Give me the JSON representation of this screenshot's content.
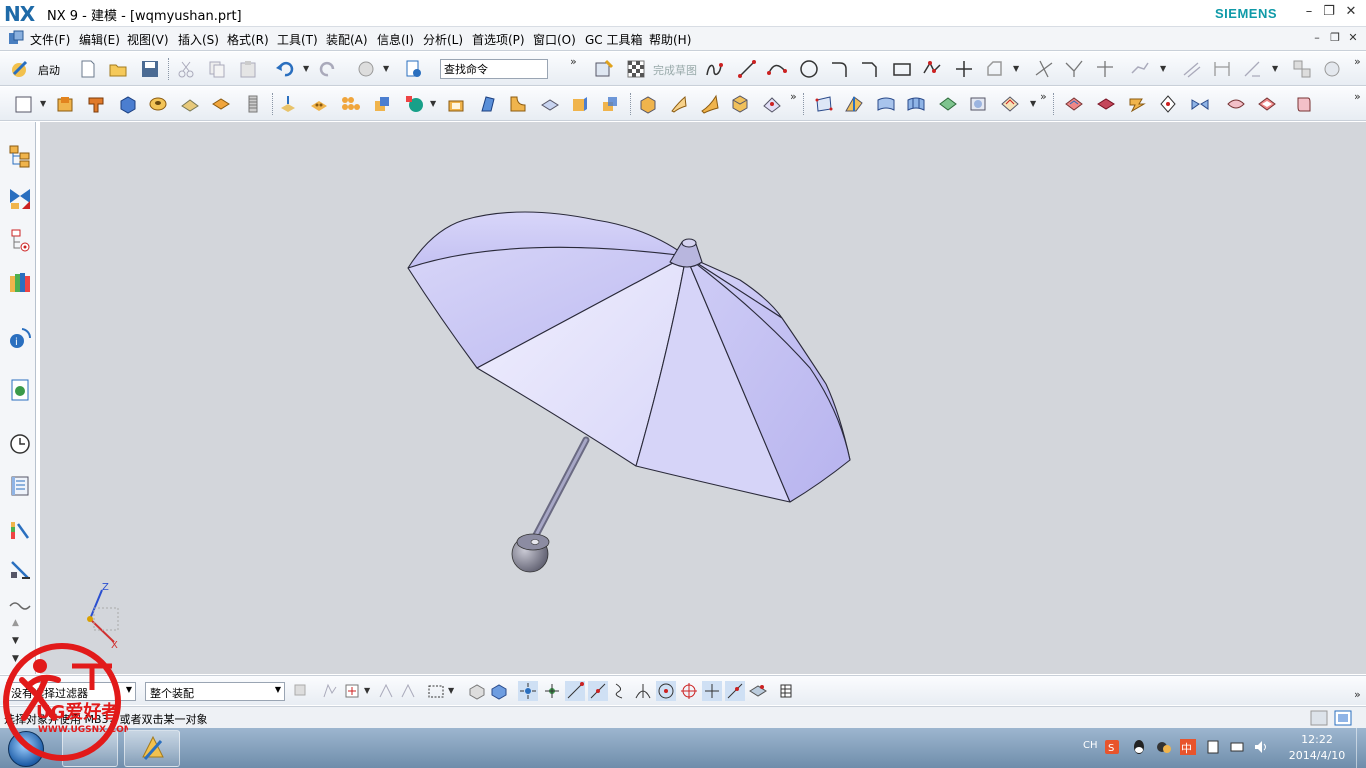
{
  "titlebar": {
    "logo": "NX",
    "title": "NX 9 - 建模 - [wqmyushan.prt]",
    "brand": "SIEMENS"
  },
  "menu": {
    "items": [
      "文件(F)",
      "编辑(E)",
      "视图(V)",
      "插入(S)",
      "格式(R)",
      "工具(T)",
      "装配(A)",
      "信息(I)",
      "分析(L)",
      "首选项(P)",
      "窗口(O)",
      "GC 工具箱",
      "帮助(H)"
    ]
  },
  "toolbar": {
    "start_label": "启动",
    "command_search_value": "查找命令",
    "finish_sketch_label": "完成草图"
  },
  "selection": {
    "filter_value": "没有选择过滤器",
    "scope_value": "整个装配"
  },
  "status": {
    "text": "选择对象并使用 MB3，或者双击某一对象"
  },
  "triad": {
    "z_label": "Z",
    "x_label": "X"
  },
  "taskbar": {
    "language": "CH",
    "time": "12:22",
    "date": "2014/4/10"
  },
  "watermark": {
    "text": "UG爱好者",
    "url": "WWW.UGSNX.COM"
  },
  "colors": {
    "canopy": "#c9c7f2",
    "canopy_light": "#e2e1fb",
    "viewport_bg": "#d3d6db",
    "accent_blue": "#1e6aa8",
    "siemens_teal": "#0f9aa8"
  }
}
